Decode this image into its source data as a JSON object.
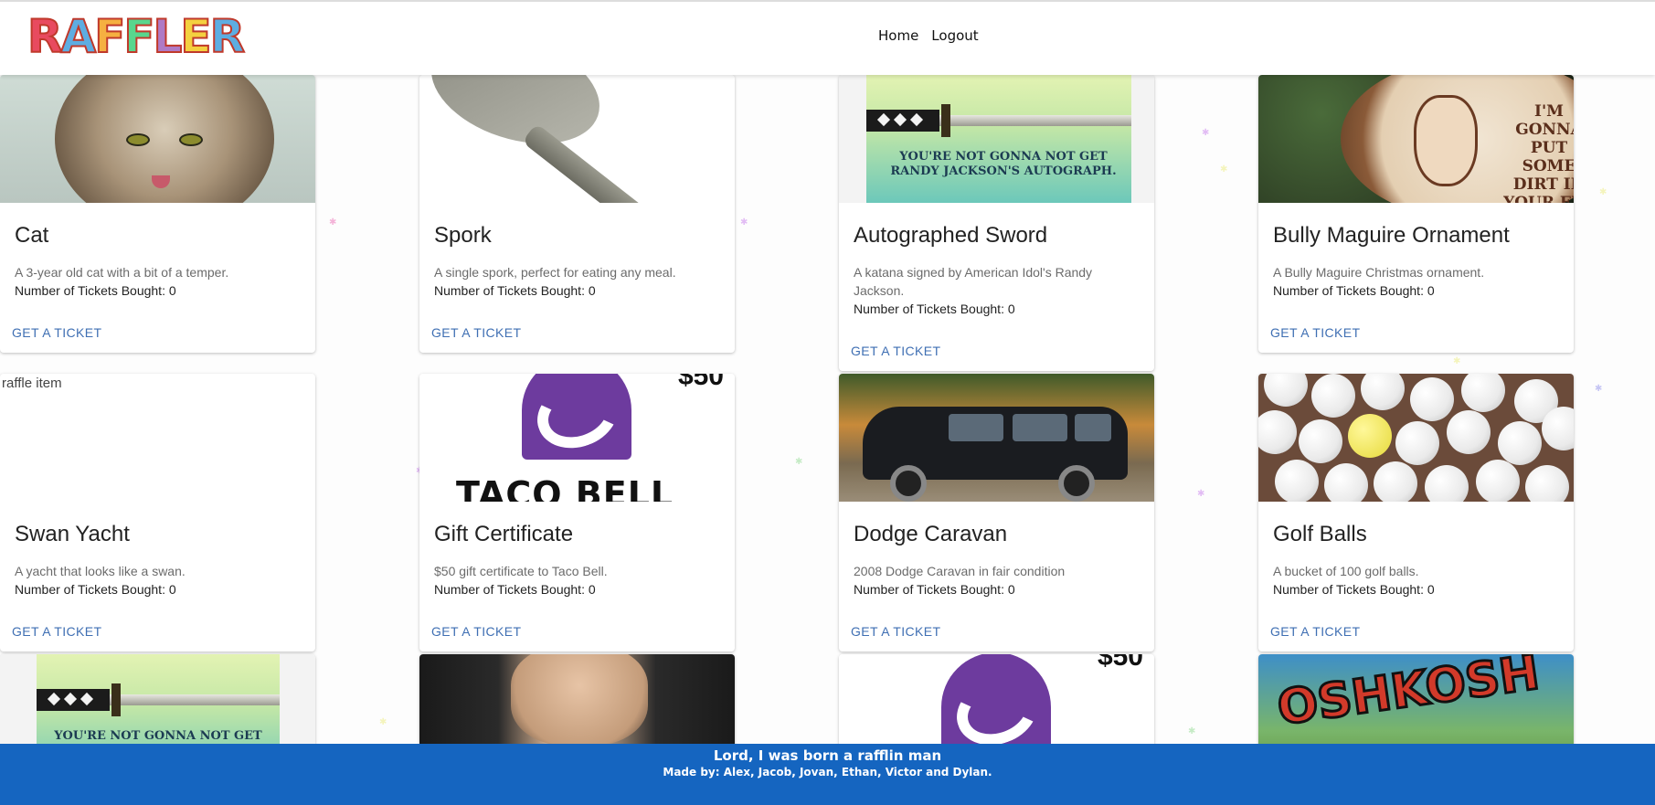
{
  "header": {
    "logo_text": "RAFFLER",
    "nav": [
      {
        "label": "Home"
      },
      {
        "label": "Logout"
      }
    ]
  },
  "cards": [
    {
      "title": "Cat",
      "description": "A 3-year old cat with a bit of a temper.",
      "tickets": "Number of Tickets Bought: 0",
      "action": "GET A TICKET"
    },
    {
      "title": "Spork",
      "description": "A single spork, perfect for eating any meal.",
      "tickets": "Number of Tickets Bought: 0",
      "action": "GET A TICKET"
    },
    {
      "title": "Autographed Sword",
      "description": "A katana signed by American Idol's Randy Jackson.",
      "tickets": "Number of Tickets Bought: 0",
      "action": "GET A TICKET",
      "image_text": "YOU'RE NOT GONNA NOT GET RANDY JACKSON'S AUTOGRAPH."
    },
    {
      "title": "Bully Maguire Ornament",
      "description": "A Bully Maguire Christmas ornament.",
      "tickets": "Number of Tickets Bought: 0",
      "action": "GET A TICKET",
      "image_text": "I'M GONNA PUT SOME DIRT IN YOUR EYE"
    },
    {
      "title": "Swan Yacht",
      "description": "A yacht that looks like a swan.",
      "tickets": "Number of Tickets Bought: 0",
      "action": "GET A TICKET",
      "image_alt": "raffle item"
    },
    {
      "title": "Gift Certificate",
      "description": "$50 gift certificate to Taco Bell.",
      "tickets": "Number of Tickets Bought: 0",
      "action": "GET A TICKET",
      "image_text": "TACO BELL",
      "image_price": "$50"
    },
    {
      "title": "Dodge Caravan",
      "description": "2008 Dodge Caravan in fair condition",
      "tickets": "Number of Tickets Bought: 0",
      "action": "GET A TICKET"
    },
    {
      "title": "Golf Balls",
      "description": "A bucket of 100 golf balls.",
      "tickets": "Number of Tickets Bought: 0",
      "action": "GET A TICKET"
    }
  ],
  "partial_cards": [
    {
      "image_text": "YOU'RE NOT GONNA NOT GET"
    },
    {},
    {
      "image_price": "$50"
    },
    {
      "image_text": "OSHKOSH"
    }
  ],
  "footer": {
    "title": "Lord, I was born a rafflin man",
    "credits": "Made by: Alex, Jacob, Jovan, Ethan, Victor and Dylan."
  },
  "colors": {
    "footer_bg": "#1565c0",
    "action_link": "#3f6fb3"
  }
}
